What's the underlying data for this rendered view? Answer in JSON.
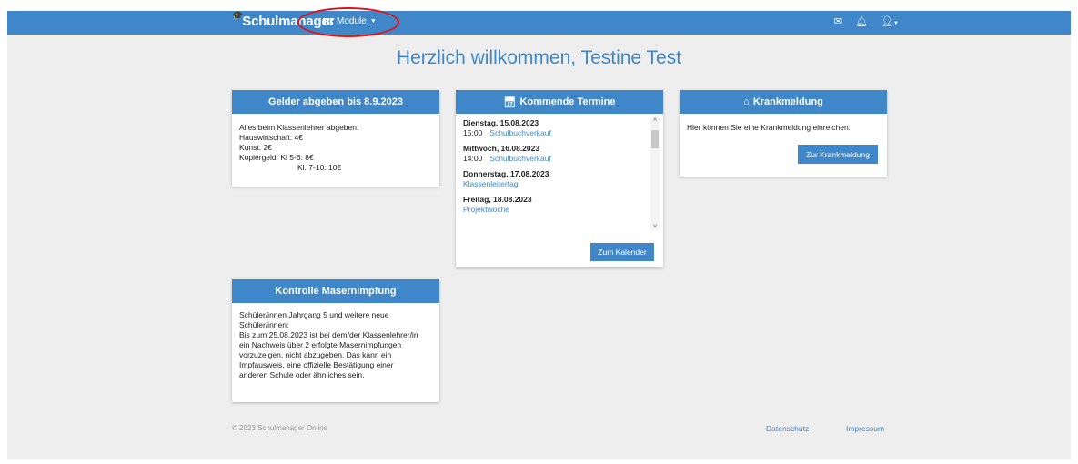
{
  "navbar": {
    "brand": "Schulmanager",
    "module_label": "Module",
    "icons": [
      "mail-icon",
      "bell-icon",
      "user-icon"
    ]
  },
  "welcome": "Herzlich willkommen, Testine Test",
  "gelder": {
    "title": "Gelder abgeben bis 8.9.2023",
    "lines": [
      "Alles beim Klassenlehrer abgeben.",
      "Hauswirtschaft: 4€",
      "Kunst: 2€",
      "Kopiergeld: Kl 5-6:  8€",
      "Kl. 7-10: 10€"
    ]
  },
  "termine": {
    "title": "Kommende Termine",
    "events": [
      {
        "date": "Dienstag, 15.08.2023",
        "time": "15:00",
        "name": "Schulbuchverkauf"
      },
      {
        "date": "Mittwoch, 16.08.2023",
        "time": "14:00",
        "name": "Schulbuchverkauf"
      },
      {
        "date": "Donnerstag, 17.08.2023",
        "time": "",
        "name": "Klassenleitertag"
      },
      {
        "date": "Freitag, 18.08.2023",
        "time": "",
        "name": "Projektwoche"
      }
    ],
    "button": "Zum Kalender"
  },
  "krank": {
    "title": "Krankmeldung",
    "text": "Hier können Sie eine Krankmeldung einreichen.",
    "button": "Zur Krankmeldung"
  },
  "masern": {
    "title": "Kontrolle Masernimpfung",
    "lines": [
      "Schüler/innen Jahrgang 5 und weitere neue",
      "Schüler/innen:",
      "Bis zum 25.08.2023 ist bei dem/der Klassenlehrer/in",
      "ein Nachweis über 2 erfolgte Masernimpfungen",
      "vorzuzeigen, nicht abzugeben. Das kann ein",
      "Impfausweis, eine offizielle Bestätigung einer",
      "anderen Schule oder ähnliches sein."
    ]
  },
  "footer": {
    "copyright": "© 2023 Schulmanager Online",
    "datenschutz": "Datenschutz",
    "impressum": "Impressum"
  },
  "colors": {
    "primary": "#3f87c8",
    "annotation": "#e0131b",
    "background": "#eeeeee"
  }
}
